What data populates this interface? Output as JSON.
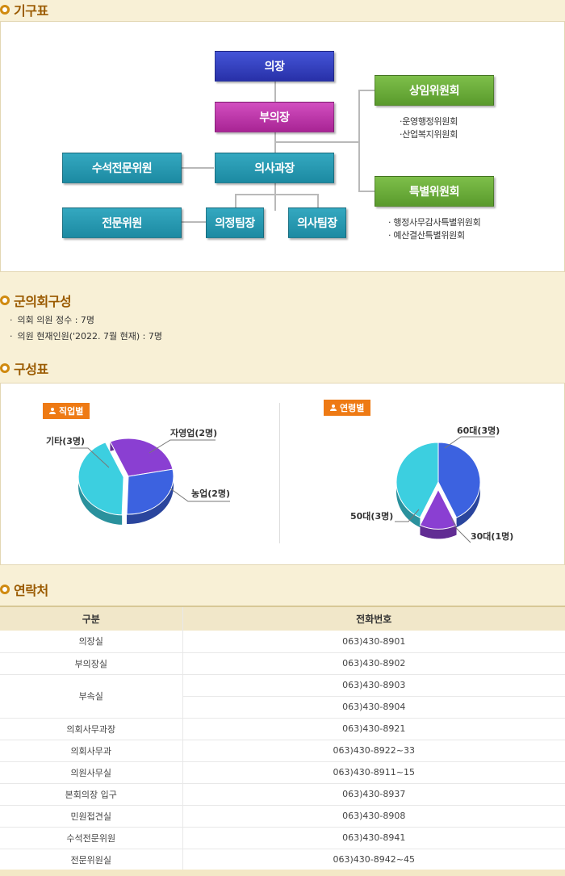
{
  "sections": {
    "org": "기구표",
    "council": "군의회구성",
    "composition": "구성표",
    "contact": "연락처"
  },
  "org": {
    "chair": "의장",
    "vice_chair": "부의장",
    "clerk": "의사과장",
    "senior_expert": "수석전문위원",
    "expert": "전문위원",
    "policy_lead": "의정팀장",
    "proceedings_lead": "의사팀장",
    "standing": "상임위원회",
    "standing_items": [
      "·운영행정위원회",
      "·산업복지위원회"
    ],
    "special": "특별위원회",
    "special_items": [
      "· 행정사무감사특별위원회",
      "· 예산결산특별위원회"
    ]
  },
  "council_info": [
    "의회 의원 정수 : 7명",
    "의원 현재인원('2022. 7월 현재) : 7명"
  ],
  "chart_data": [
    {
      "type": "pie",
      "title": "직업별",
      "categories": [
        "기타(3명)",
        "자영업(2명)",
        "농업(2명)"
      ],
      "values": [
        3,
        2,
        2
      ],
      "colors": [
        "#3ccfe0",
        "#8a3fd2",
        "#3c62e0"
      ]
    },
    {
      "type": "pie",
      "title": "연령별",
      "categories": [
        "60대(3명)",
        "30대(1명)",
        "50대(3명)"
      ],
      "values": [
        3,
        1,
        3
      ],
      "colors": [
        "#3c62e0",
        "#8a3fd2",
        "#3ccfe0"
      ]
    }
  ],
  "contact": {
    "headers": [
      "구분",
      "전화번호"
    ],
    "rows": [
      {
        "name": "의장실",
        "phones": [
          "063)430-8901"
        ]
      },
      {
        "name": "부의장실",
        "phones": [
          "063)430-8902"
        ]
      },
      {
        "name": "부속실",
        "phones": [
          "063)430-8903",
          "063)430-8904"
        ]
      },
      {
        "name": "의회사무과장",
        "phones": [
          "063)430-8921"
        ]
      },
      {
        "name": "의회사무과",
        "phones": [
          "063)430-8922~33"
        ]
      },
      {
        "name": "의원사무실",
        "phones": [
          "063)430-8911~15"
        ]
      },
      {
        "name": "본회의장 입구",
        "phones": [
          "063)430-8937"
        ]
      },
      {
        "name": "민원접견실",
        "phones": [
          "063)430-8908"
        ]
      },
      {
        "name": "수석전문위원",
        "phones": [
          "063)430-8941"
        ]
      },
      {
        "name": "전문위원실",
        "phones": [
          "063)430-8942~45"
        ]
      }
    ]
  }
}
